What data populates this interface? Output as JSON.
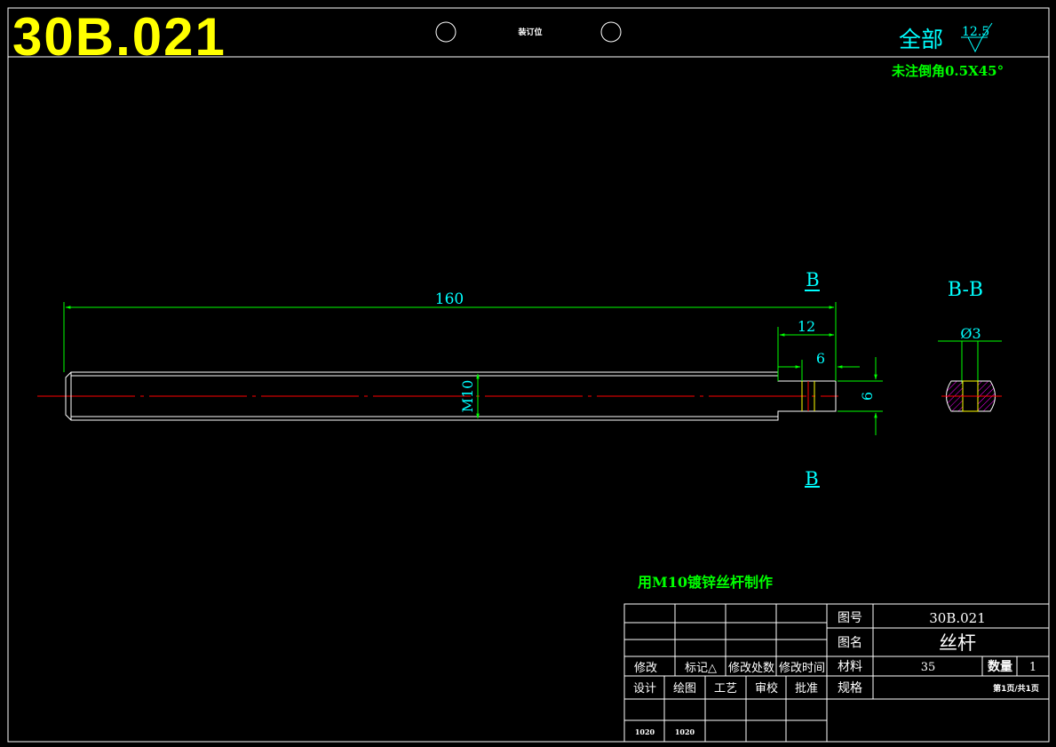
{
  "drawing_code": "30B.021",
  "binding_label": "装订位",
  "roughness": {
    "label": "全部",
    "value": "12.5"
  },
  "chamfer_note": "未注倒角0.5X45°",
  "dimensions": {
    "overall_length": "160",
    "end_length": "12",
    "slot_width": "6",
    "slot_height": "6",
    "thread": "M10",
    "hole_diameter": "Ø3"
  },
  "section": {
    "mark": "B",
    "title": "B-B"
  },
  "material_note": "用M10镀锌丝杆制作",
  "title_block": {
    "drawing_no_label": "图号",
    "drawing_no": "30B.021",
    "name_label": "图名",
    "name": "丝杆",
    "material_label": "材料",
    "material": "35",
    "quantity_label": "数量",
    "quantity": "1",
    "spec_label": "规格",
    "page": "第1页/共1页",
    "rev_headers": [
      "修改",
      "标记△",
      "修改处数",
      "修改时间"
    ],
    "role_headers": [
      "设计",
      "绘图",
      "工艺",
      "审校",
      "批准"
    ],
    "dates": [
      "1020",
      "1020"
    ]
  },
  "colors": {
    "background": "#000000",
    "frame": "#ffffff",
    "dimension": "#00ff00",
    "annotation": "#00ffff",
    "centerline": "#ff0000",
    "title": "#ffff00",
    "hatch": "#ff00ff"
  }
}
